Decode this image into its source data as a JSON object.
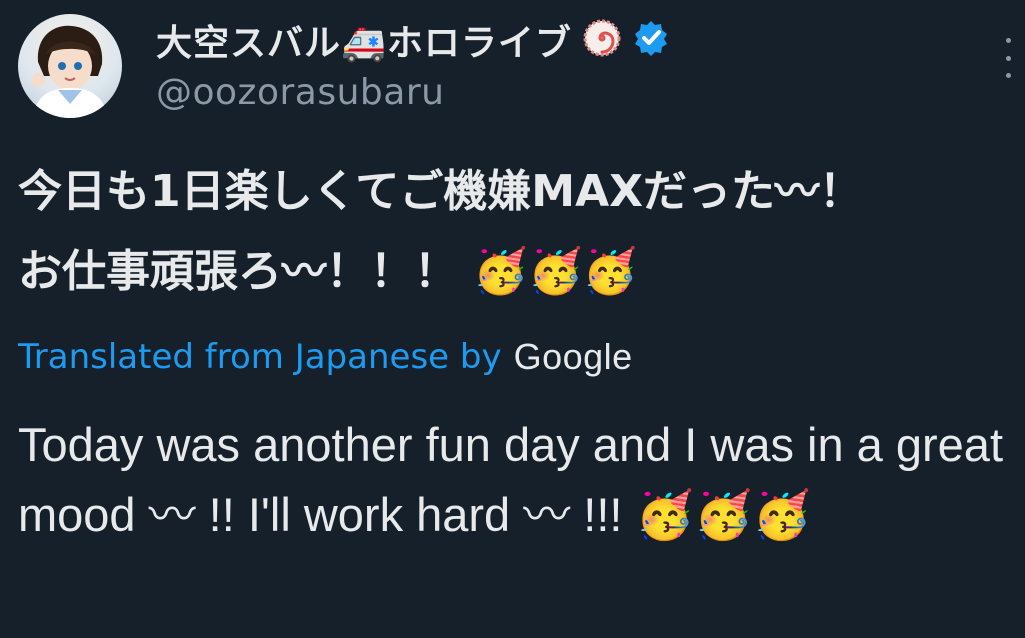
{
  "post": {
    "display_name": "大空スバル🚑ホロライブ",
    "handle": "@oozorasubaru",
    "original_text": "今日も1日楽しくてご機嫌MAXだった〰！\nお仕事頑張ろ〰！！！ 🥳🥳🥳",
    "translation_label": "Translated from Japanese by",
    "translation_provider": "Google",
    "translated_text": "Today was another fun day and I was in a great mood 〰 !! I'll work hard 〰 !!! 🥳🥳🥳"
  },
  "icons": {
    "profile_badge": "naruto-swirl-icon",
    "verified": "verified-badge-icon",
    "more": "more-options-icon"
  },
  "colors": {
    "background": "#15202b",
    "text": "#e7e9ea",
    "muted": "#8b98a5",
    "accent": "#1d9bf0"
  }
}
